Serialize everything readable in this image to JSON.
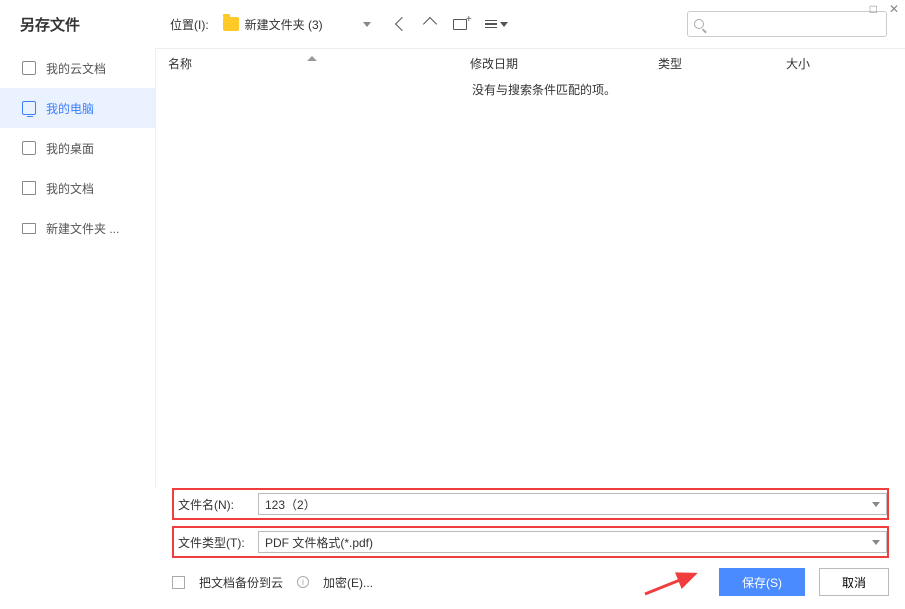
{
  "title": "另存文件",
  "location": {
    "label": "位置(I):",
    "folder": "新建文件夹 (3)"
  },
  "search_placeholder": "",
  "sidebar": {
    "items": [
      {
        "label": "我的云文档",
        "icon": "cube"
      },
      {
        "label": "我的电脑",
        "icon": "monitor",
        "active": true
      },
      {
        "label": "我的桌面",
        "icon": "desktop"
      },
      {
        "label": "我的文档",
        "icon": "doc"
      },
      {
        "label": "新建文件夹 ...",
        "icon": "folder"
      }
    ]
  },
  "columns": {
    "name": "名称",
    "date": "修改日期",
    "type": "类型",
    "size": "大小"
  },
  "empty_message": "没有与搜索条件匹配的项。",
  "form": {
    "filename_label": "文件名(N):",
    "filename_value": "123（2）",
    "filetype_label": "文件类型(T):",
    "filetype_value": "PDF 文件格式(*.pdf)",
    "backup_label": "把文档备份到云",
    "encrypt_label": "加密(E)...",
    "save_label": "保存(S)",
    "cancel_label": "取消"
  },
  "colors": {
    "accent": "#4a8cff",
    "highlight": "#f03d3d"
  }
}
